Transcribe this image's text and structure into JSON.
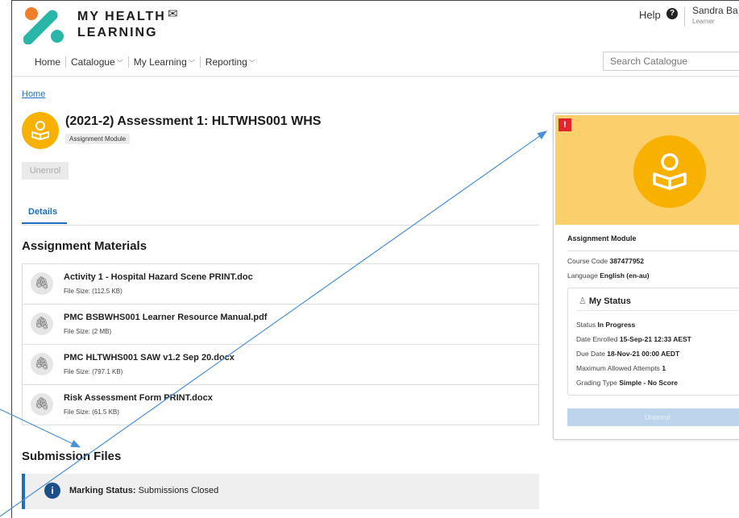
{
  "header": {
    "brand_line1": "MY HEALTH",
    "brand_line2": "LEARNING",
    "mail_icon": "envelope-icon",
    "help_label": "Help",
    "user_name": "Sandra Ba",
    "user_role": "Learner",
    "search_placeholder": "Search Catalogue"
  },
  "nav": [
    {
      "label": "Home",
      "dropdown": false
    },
    {
      "label": "Catalogue",
      "dropdown": true
    },
    {
      "label": "My Learning",
      "dropdown": true
    },
    {
      "label": "Reporting",
      "dropdown": true
    }
  ],
  "breadcrumb": "Home",
  "course": {
    "title": "(2021-2) Assessment 1: HLTWHS001 WHS",
    "type_badge": "Assignment Module",
    "unenrol_label": "Unenrol"
  },
  "tabs": {
    "details": "Details"
  },
  "materials": {
    "heading": "Assignment Materials",
    "items": [
      {
        "name": "Activity 1 - Hospital Hazard Scene PRINT.doc",
        "size": "File Size: (112.5 KB)"
      },
      {
        "name": "PMC BSBWHS001 Learner Resource Manual.pdf",
        "size": "File Size: (2 MB)"
      },
      {
        "name": "PMC HLTWHS001 SAW v1.2 Sep 20.docx",
        "size": "File Size: (797.1 KB)"
      },
      {
        "name": "Risk Assessment Form PRINT.docx",
        "size": "File Size: (61.5 KB)"
      }
    ]
  },
  "submission": {
    "heading": "Submission Files",
    "status_label": "Marking Status:",
    "status_value": "Submissions Closed"
  },
  "card": {
    "alert": "!",
    "type": "Assignment Module",
    "course_code_label": "Course Code",
    "course_code": "387477952",
    "language_label": "Language",
    "language": "English (en-au)",
    "my_status": {
      "title": "My Status",
      "status_label": "Status",
      "status": "In Progress",
      "enrolled_label": "Date Enrolled",
      "enrolled": "15-Sep-21 12:33 AEST",
      "due_label": "Due Date",
      "due": "18-Nov-21 00:00 AEDT",
      "attempts_label": "Maximum Allowed Attempts",
      "attempts": "1",
      "grading_label": "Grading Type",
      "grading": "Simple - No Score"
    },
    "unenrol_label": "Unenrol"
  },
  "colors": {
    "accent_blue": "#1a6fb8",
    "course_yellow": "#f9b100",
    "banner_yellow": "#fbd06c",
    "alert_red": "#e0262b",
    "annotation_arrow": "#4a90d9"
  }
}
